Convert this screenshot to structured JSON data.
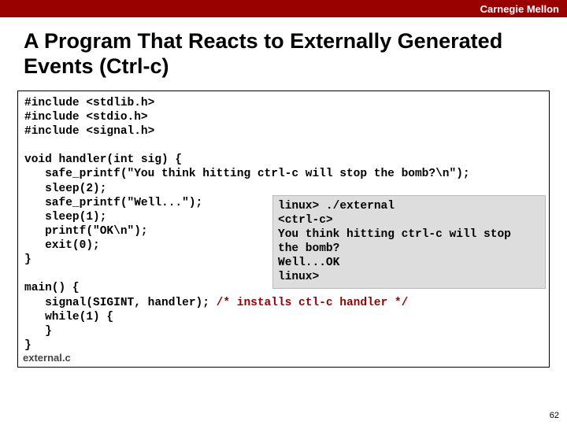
{
  "header": {
    "brand": "Carnegie Mellon"
  },
  "slide": {
    "title": "A Program That Reacts to Externally Generated Events (Ctrl-c)",
    "page_number": "62"
  },
  "code": {
    "includes": "#include <stdlib.h>\n#include <stdio.h>\n#include <signal.h>",
    "body_top": "void handler(int sig) {\n   safe_printf(\"You think hitting ctrl-c will stop the bomb?\\n\");\n   sleep(2);\n   safe_printf(\"Well...\");\n   sleep(1);\n   printf(\"OK\\n\");\n   exit(0);\n}\n\nmain() {",
    "signal_line_pre": "   signal(SIGINT, handler); ",
    "signal_comment": "/* installs ctl-c handler */",
    "body_bottom": "   while(1) {\n   }\n}",
    "filename": "external.c"
  },
  "terminal": {
    "output": "linux> ./external\n<ctrl-c>\nYou think hitting ctrl-c will stop\nthe bomb?\nWell...OK\nlinux>"
  }
}
